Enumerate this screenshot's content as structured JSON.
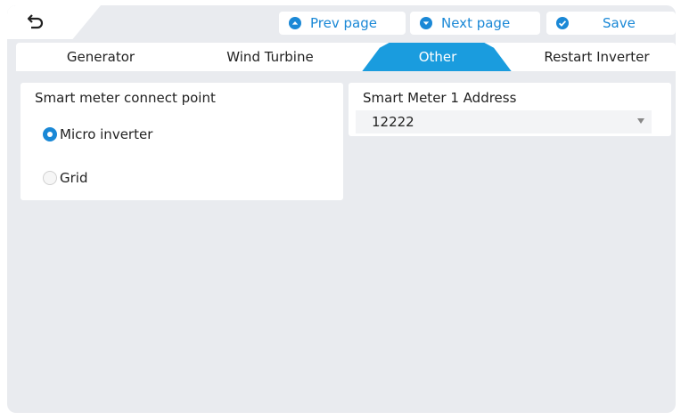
{
  "toolbar": {
    "prev_label": "Prev page",
    "next_label": "Next page",
    "save_label": "Save"
  },
  "tabs": [
    {
      "label": "Generator",
      "active": false
    },
    {
      "label": "Wind Turbine",
      "active": false
    },
    {
      "label": "Other",
      "active": true
    },
    {
      "label": "Restart Inverter",
      "active": false
    }
  ],
  "smart_meter_point": {
    "title": "Smart meter connect point",
    "options": [
      {
        "label": "Micro inverter",
        "selected": true
      },
      {
        "label": "Grid",
        "selected": false
      }
    ]
  },
  "smart_meter_address": {
    "title": "Smart Meter 1 Address",
    "value": "12222"
  },
  "colors": {
    "accent": "#1a9cde",
    "background": "#e9ebef"
  }
}
